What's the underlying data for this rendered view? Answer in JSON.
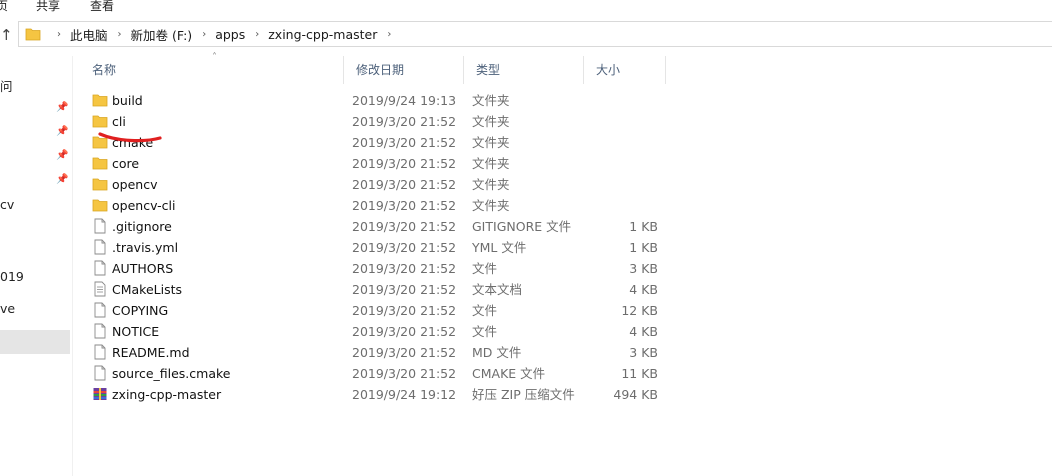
{
  "ribbon": {
    "tabs": [
      "页",
      "共享",
      "查看"
    ]
  },
  "address": {
    "crumbs": [
      "此电脑",
      "新加卷 (F:)",
      "apps",
      "zxing-cpp-master"
    ]
  },
  "sidebar": {
    "fragments": [
      "问",
      "cv",
      "019",
      "ve"
    ]
  },
  "columns": {
    "name": "名称",
    "date": "修改日期",
    "type": "类型",
    "size": "大小"
  },
  "files": [
    {
      "name": "build",
      "date": "2019/9/24 19:13",
      "type": "文件夹",
      "size": "",
      "icon": "folder-icon"
    },
    {
      "name": "cli",
      "date": "2019/3/20 21:52",
      "type": "文件夹",
      "size": "",
      "icon": "folder-icon"
    },
    {
      "name": "cmake",
      "date": "2019/3/20 21:52",
      "type": "文件夹",
      "size": "",
      "icon": "folder-icon"
    },
    {
      "name": "core",
      "date": "2019/3/20 21:52",
      "type": "文件夹",
      "size": "",
      "icon": "folder-icon"
    },
    {
      "name": "opencv",
      "date": "2019/3/20 21:52",
      "type": "文件夹",
      "size": "",
      "icon": "folder-icon"
    },
    {
      "name": "opencv-cli",
      "date": "2019/3/20 21:52",
      "type": "文件夹",
      "size": "",
      "icon": "folder-icon"
    },
    {
      "name": ".gitignore",
      "date": "2019/3/20 21:52",
      "type": "GITIGNORE 文件",
      "size": "1 KB",
      "icon": "file-icon"
    },
    {
      "name": ".travis.yml",
      "date": "2019/3/20 21:52",
      "type": "YML 文件",
      "size": "1 KB",
      "icon": "file-icon"
    },
    {
      "name": "AUTHORS",
      "date": "2019/3/20 21:52",
      "type": "文件",
      "size": "3 KB",
      "icon": "file-icon"
    },
    {
      "name": "CMakeLists",
      "date": "2019/3/20 21:52",
      "type": "文本文档",
      "size": "4 KB",
      "icon": "text-file-icon"
    },
    {
      "name": "COPYING",
      "date": "2019/3/20 21:52",
      "type": "文件",
      "size": "12 KB",
      "icon": "file-icon"
    },
    {
      "name": "NOTICE",
      "date": "2019/3/20 21:52",
      "type": "文件",
      "size": "4 KB",
      "icon": "file-icon"
    },
    {
      "name": "README.md",
      "date": "2019/3/20 21:52",
      "type": "MD 文件",
      "size": "3 KB",
      "icon": "file-icon"
    },
    {
      "name": "source_files.cmake",
      "date": "2019/3/20 21:52",
      "type": "CMAKE 文件",
      "size": "11 KB",
      "icon": "file-icon"
    },
    {
      "name": "zxing-cpp-master",
      "date": "2019/9/24 19:12",
      "type": "好压 ZIP 压缩文件",
      "size": "494 KB",
      "icon": "zip-archive-icon"
    }
  ],
  "colors": {
    "annotation": "#e02020",
    "folder": "#f5c542",
    "header_text": "#4c607a",
    "secondary_text": "#6d6d6d"
  }
}
